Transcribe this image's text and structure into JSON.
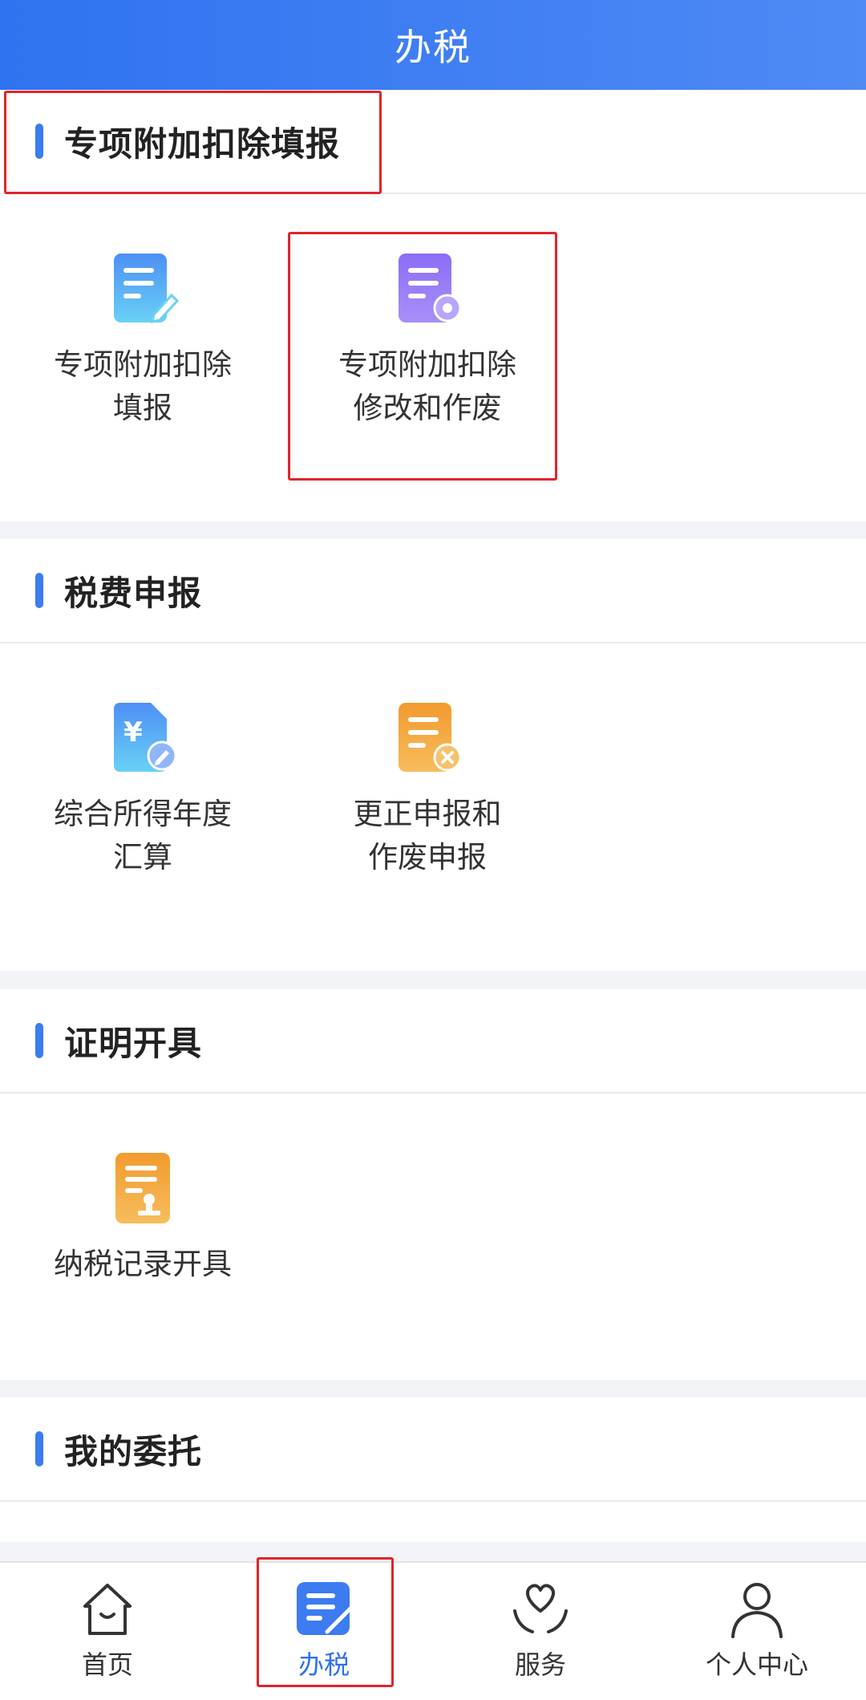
{
  "header": {
    "title": "办税"
  },
  "sections": [
    {
      "title": "专项附加扣除填报",
      "items": [
        {
          "label_line1": "专项附加扣除",
          "label_line2": "填报",
          "icon": "edit-document-icon"
        },
        {
          "label_line1": "专项附加扣除",
          "label_line2": "修改和作废",
          "icon": "settings-document-icon"
        }
      ]
    },
    {
      "title": "税费申报",
      "items": [
        {
          "label_line1": "综合所得年度",
          "label_line2": "汇算",
          "icon": "yuan-document-icon"
        },
        {
          "label_line1": "更正申报和",
          "label_line2": "作废申报",
          "icon": "cancel-document-icon"
        }
      ]
    },
    {
      "title": "证明开具",
      "items": [
        {
          "label_line1": "纳税记录开具",
          "label_line2": "",
          "icon": "stamp-document-icon"
        }
      ]
    },
    {
      "title": "我的委托",
      "items": []
    }
  ],
  "bottom_nav": [
    {
      "label": "首页",
      "icon": "home-icon",
      "active": false
    },
    {
      "label": "办税",
      "icon": "tax-document-icon",
      "active": true
    },
    {
      "label": "服务",
      "icon": "heart-hands-icon",
      "active": false
    },
    {
      "label": "个人中心",
      "icon": "person-icon",
      "active": false
    }
  ],
  "colors": {
    "header": "#2f73f0",
    "accent": "#3d7bf0",
    "highlight_box": "#e0242a"
  }
}
